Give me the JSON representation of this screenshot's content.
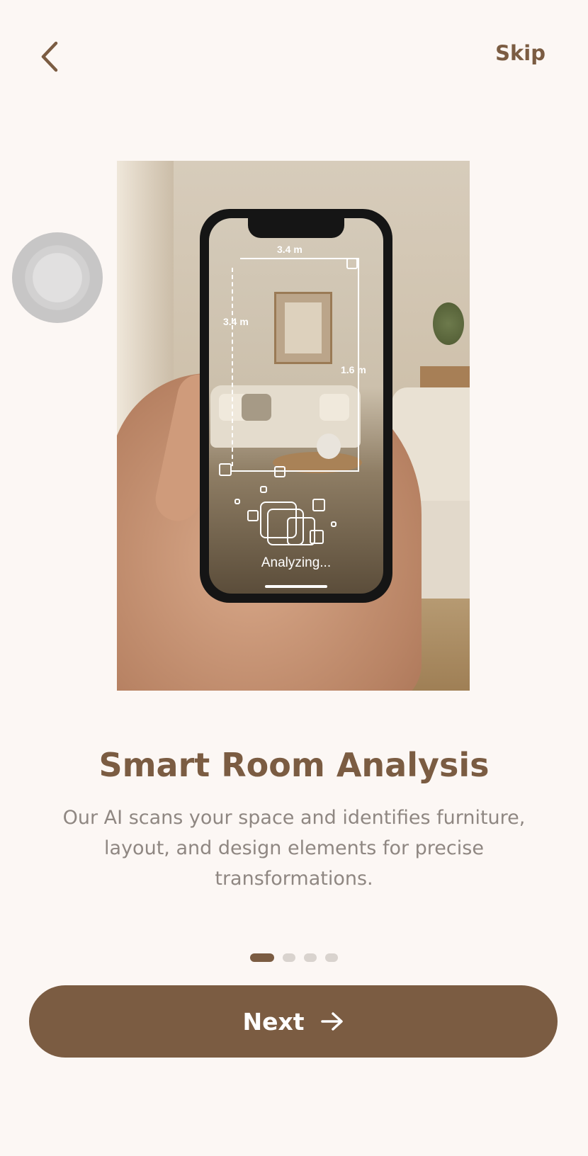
{
  "header": {
    "back_icon": "chevron-left-icon",
    "skip_label": "Skip"
  },
  "hero": {
    "measurements": {
      "top": "3.4 m",
      "left": "3.4 m",
      "right": "1.6 m"
    },
    "status_text": "Analyzing..."
  },
  "content": {
    "title": "Smart Room Analysis",
    "description": "Our AI scans your space and identifies furniture, layout, and design elements for precise transformations."
  },
  "pagination": {
    "total": 4,
    "current": 1
  },
  "footer": {
    "next_label": "Next",
    "next_icon": "arrow-right-icon"
  },
  "colors": {
    "accent": "#7b5c42",
    "background": "#fcf7f4",
    "muted_text": "#8f8782",
    "inactive_dot": "#d9d3ce"
  }
}
